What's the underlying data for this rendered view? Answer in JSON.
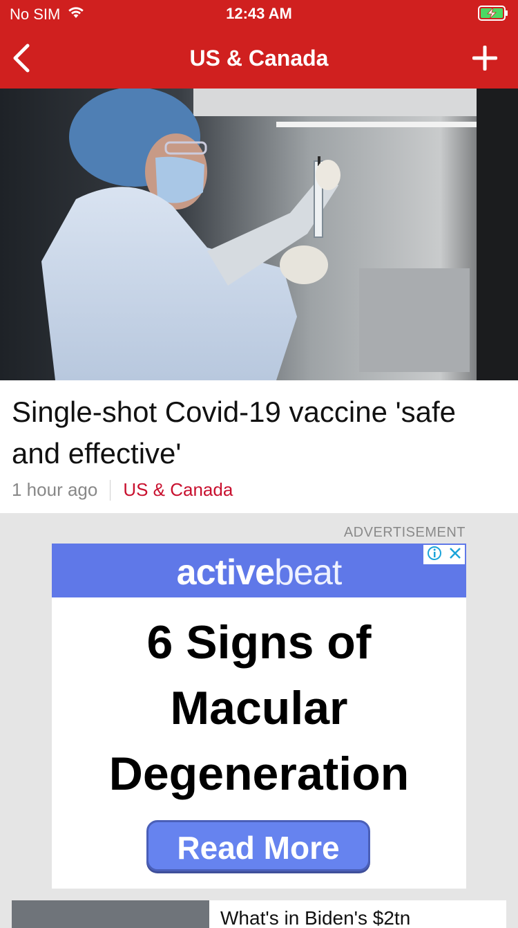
{
  "status_bar": {
    "carrier": "No SIM",
    "time": "12:43 AM",
    "icons": [
      "wifi-icon",
      "battery-charging-icon"
    ]
  },
  "nav": {
    "title": "US & Canada",
    "back_icon": "chevron-left-icon",
    "add_icon": "plus-icon"
  },
  "hero_image": {
    "description_icon": "photo"
  },
  "article": {
    "title": "Single-shot Covid-19 vaccine 'safe and effective'",
    "time_ago": "1 hour ago",
    "section": "US & Canada"
  },
  "advertisement": {
    "label": "ADVERTISEMENT",
    "brand_part1": "active",
    "brand_part2": "beat",
    "headline": "6 Signs of Macular Degeneration",
    "cta": "Read More",
    "choices_icons": [
      "info-icon",
      "close-icon"
    ]
  },
  "next_article": {
    "title": "What's in Biden's $2tn"
  },
  "colors": {
    "brand_red": "#d0201f",
    "section_red": "#c8102e",
    "ad_blue": "#5f78e8"
  }
}
